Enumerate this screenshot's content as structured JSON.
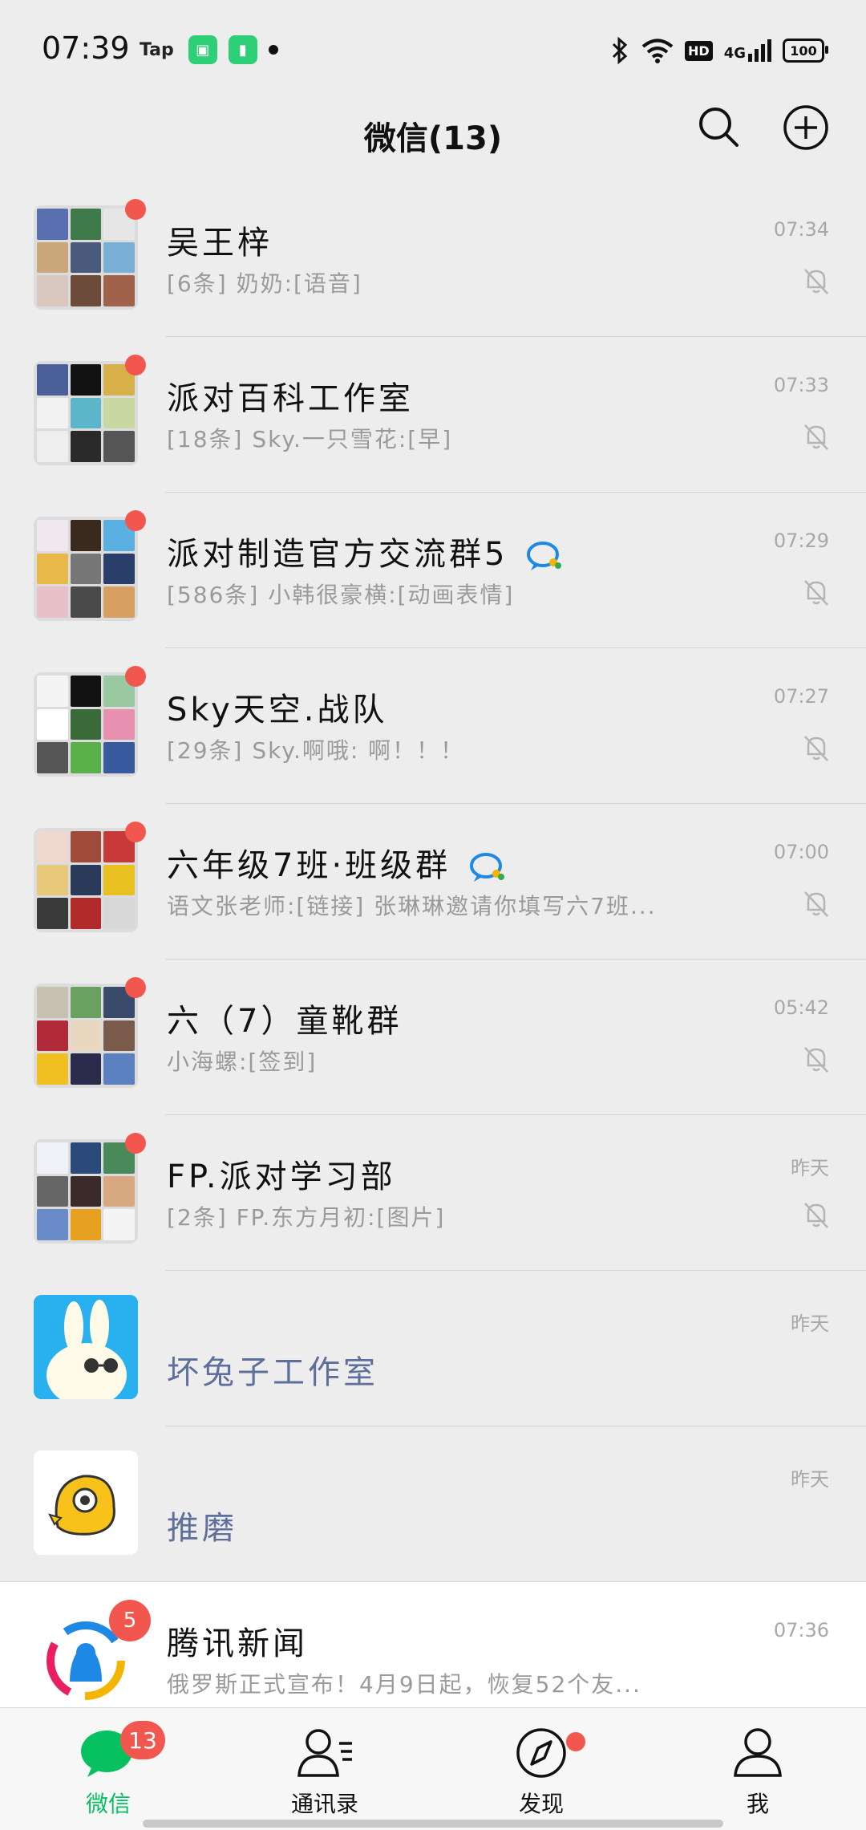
{
  "status_bar": {
    "time": "07:39",
    "tap_label": "Tap",
    "network": "4G",
    "hd": "HD",
    "battery": "100"
  },
  "header": {
    "title": "微信(13)"
  },
  "chats": [
    {
      "name": "吴王梓",
      "preview": "[6条] 奶奶:[语音]",
      "time": "07:34",
      "muted": true,
      "unread_dot": true
    },
    {
      "name": "派对百科工作室",
      "preview": "[18条] Sky.一只雪花:[早]",
      "time": "07:33",
      "muted": true,
      "unread_dot": true
    },
    {
      "name": "派对制造官方交流群5",
      "preview": "[586条] 小韩很豪横:[动画表情]",
      "time": "07:29",
      "muted": true,
      "unread_dot": true
    },
    {
      "name": "Sky天空.战队",
      "preview": "[29条] Sky.啊哦: 啊！！！",
      "time": "07:27",
      "muted": true,
      "unread_dot": true
    },
    {
      "name": "六年级7班·班级群",
      "preview": "语文张老师:[链接] 张琳琳邀请你填写六7班...",
      "time": "07:00",
      "muted": true,
      "unread_dot": true
    },
    {
      "name": "六（7）童靴群",
      "preview": "小海螺:[签到]",
      "time": "05:42",
      "muted": true,
      "unread_dot": true
    },
    {
      "name": "FP.派对学习部",
      "preview": "[2条] FP.东方月初:[图片]",
      "time": "昨天",
      "muted": true,
      "unread_dot": true
    },
    {
      "name": "坏兔子工作室",
      "time": "昨天"
    },
    {
      "name": "推磨",
      "time": "昨天"
    },
    {
      "name": "腾讯新闻",
      "preview": "俄罗斯正式宣布！4月9日起，恢复52个友...",
      "time": "07:36",
      "badge": "5"
    }
  ],
  "tabs": [
    {
      "label": "微信",
      "badge": "13"
    },
    {
      "label": "通讯录"
    },
    {
      "label": "发现"
    },
    {
      "label": "我"
    }
  ],
  "colors": {
    "background": "#ededed",
    "accent_green": "#07c160",
    "badge_red": "#f2574f",
    "official_blue": "#5d6f9a"
  }
}
